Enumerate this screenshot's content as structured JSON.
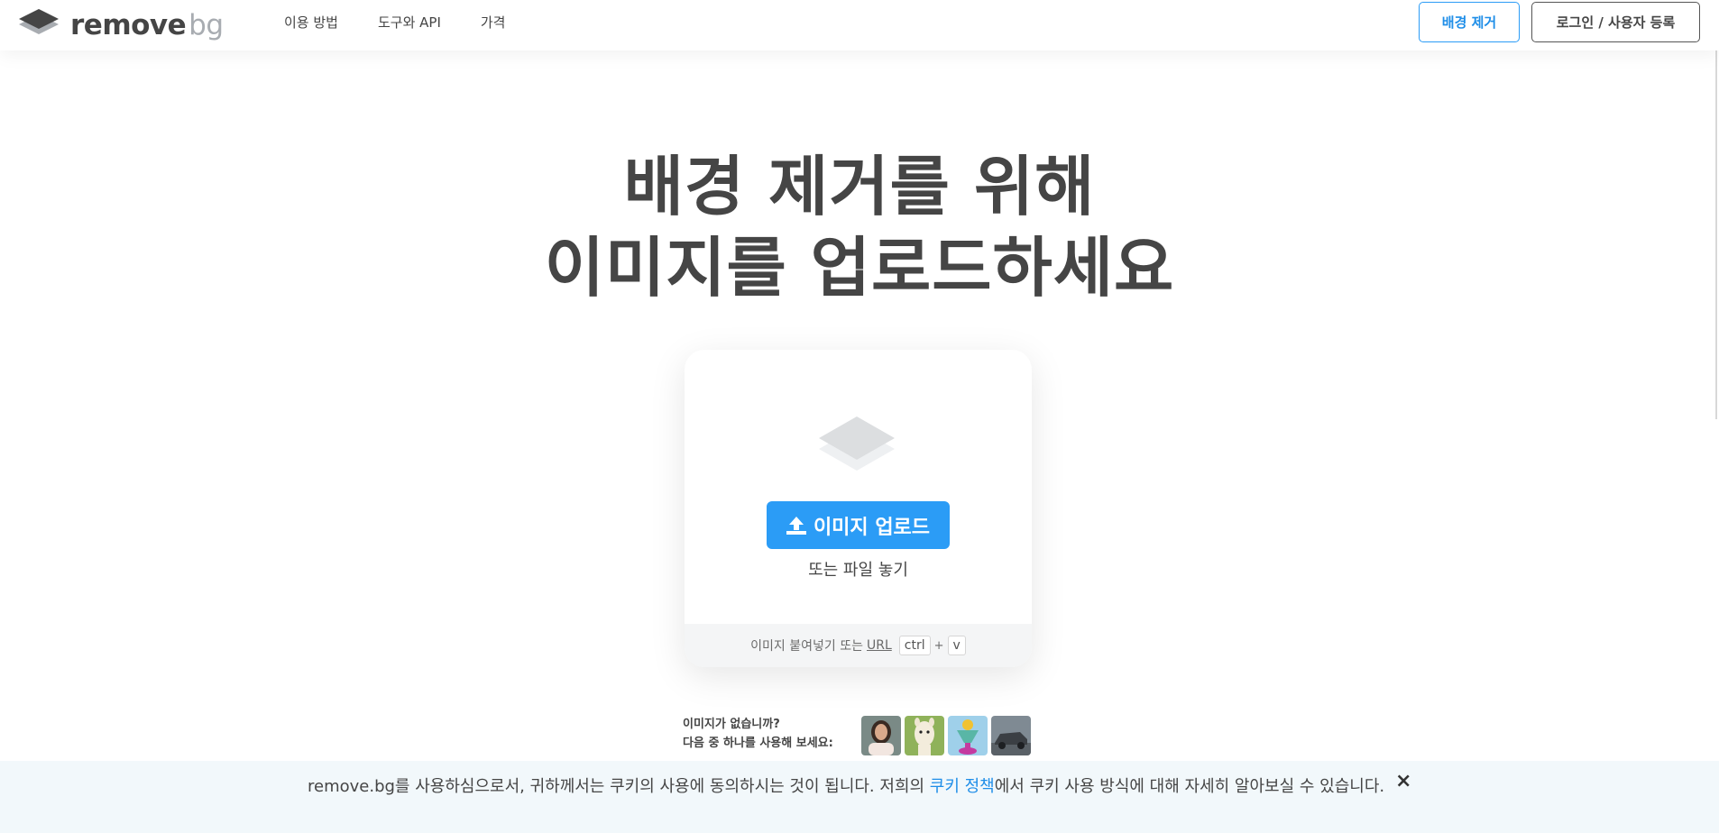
{
  "header": {
    "logo": {
      "word1": "remove",
      "word2": "bg"
    },
    "nav": [
      {
        "label": "이용 방법"
      },
      {
        "label": "도구와 API"
      },
      {
        "label": "가격"
      }
    ],
    "remove_bg_button": "배경 제거",
    "login_button": "로그인 / 사용자 등록"
  },
  "hero": {
    "line1": "배경 제거를 위해",
    "line2": "이미지를 업로드하세요"
  },
  "upload": {
    "button_label": "이미지 업로드",
    "drop_text": "또는 파일 놓기",
    "paste_prefix": "이미지 붙여넣기 또는",
    "url_label": "URL",
    "key_ctrl": "ctrl",
    "key_plus": "+",
    "key_v": "v"
  },
  "samples": {
    "line1": "이미지가 없습니까?",
    "line2": "다음 중 하나를 사용해 보세요:",
    "items": [
      {
        "name": "woman"
      },
      {
        "name": "alpaca"
      },
      {
        "name": "drink"
      },
      {
        "name": "car"
      }
    ]
  },
  "cookie": {
    "text_before": "remove.bg를 사용하심으로서, 귀하께서는 쿠키의 사용에 동의하시는 것이 됩니다. 저희의 ",
    "link": "쿠키 정책",
    "text_after": "에서 쿠키 사용 방식에 대해 자세히 알아보실 수 있습니다.",
    "close": "×"
  },
  "colors": {
    "accent": "#2b9cf6",
    "text": "#454545",
    "banner_bg": "#f2f8fb"
  }
}
